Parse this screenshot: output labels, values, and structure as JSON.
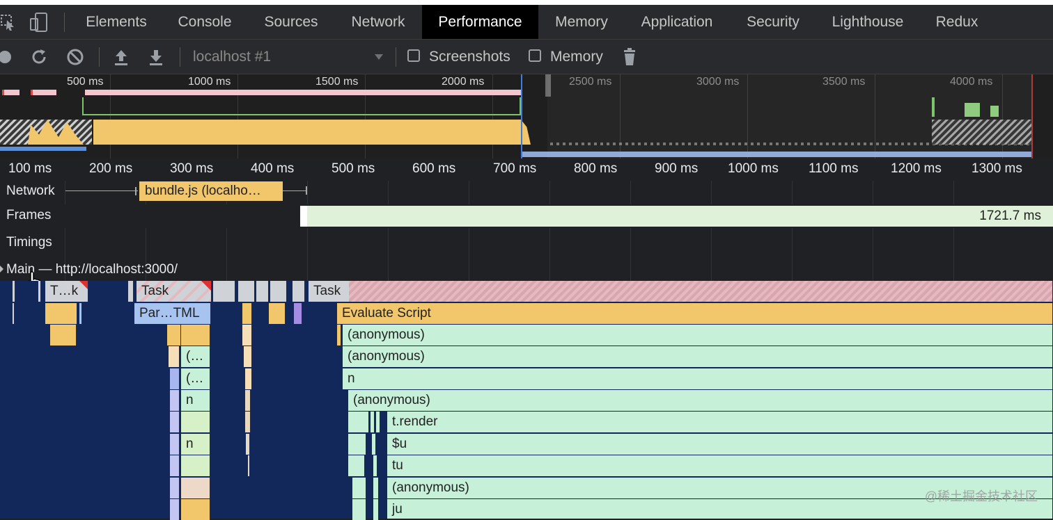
{
  "tabs": [
    "Elements",
    "Console",
    "Sources",
    "Network",
    "Performance",
    "Memory",
    "Application",
    "Security",
    "Lighthouse",
    "Redux"
  ],
  "active_tab": "Performance",
  "toolbar": {
    "profile_select": "localhost #1",
    "screenshots_label": "Screenshots",
    "memory_label": "Memory"
  },
  "overview": {
    "ticks": [
      "500 ms",
      "1000 ms",
      "1500 ms",
      "2000 ms",
      "2500 ms",
      "3000 ms",
      "3500 ms",
      "4000 ms"
    ]
  },
  "ruler": {
    "ticks": [
      "100 ms",
      "200 ms",
      "300 ms",
      "400 ms",
      "500 ms",
      "600 ms",
      "700 ms",
      "800 ms",
      "900 ms",
      "1000 ms",
      "1100 ms",
      "1200 ms",
      "1300 ms"
    ]
  },
  "tracks": {
    "network": "Network",
    "network_request": "bundle.js (localho…",
    "frames": "Frames",
    "frame_duration": "1721.7 ms",
    "timings": "Timings",
    "main": "Main — http://localhost:3000/"
  },
  "flame": {
    "task_short": "T…k",
    "task1": "Task",
    "task2": "Task",
    "parse_html": "Par…TML",
    "evaluate_script": "Evaluate Script",
    "anon1": "(anonymous)",
    "anon2": "(anonymous)",
    "n1": "n",
    "anon3": "(anonymous)",
    "t_render": "t.render",
    "su": "$u",
    "tu": "tu",
    "anon4": "(anonymous)",
    "ju": "ju",
    "ellipsis1": "(…",
    "ellipsis2": "(…",
    "n_small1": "n",
    "n_small2": "n"
  },
  "watermark": "@稀土掘金技术社区",
  "colors": {
    "scripting": "#f2c66a",
    "loading": "#a7c3f0",
    "frame": "#dff1d8",
    "task": "#cfd2d6",
    "call": "#c6f0d8"
  }
}
